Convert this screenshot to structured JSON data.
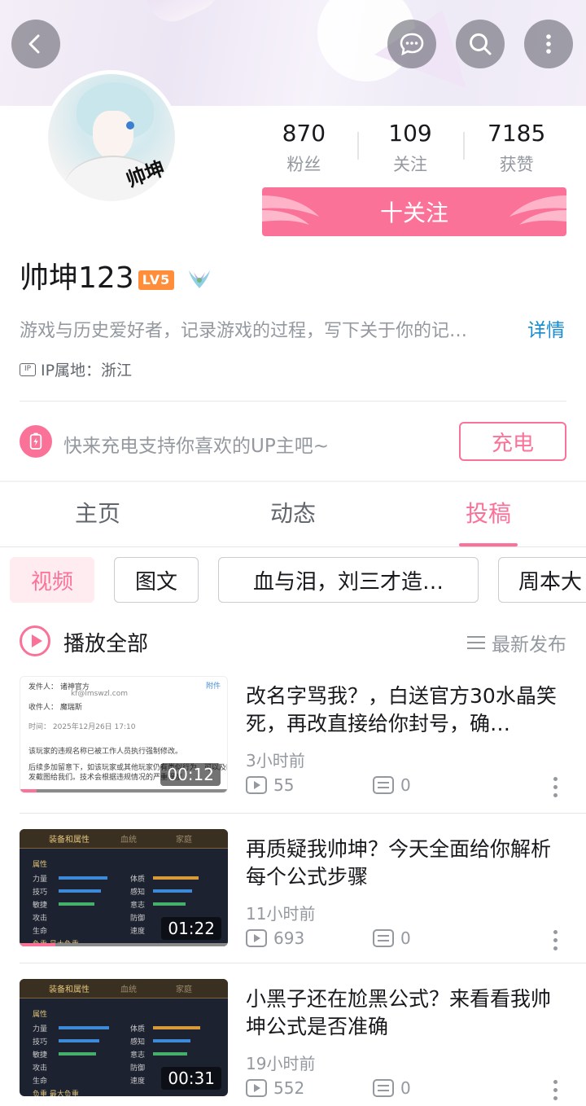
{
  "header": {
    "back_icon": "chevron-left-icon",
    "message_icon": "chat-bubble-icon",
    "search_icon": "search-icon",
    "more_icon": "more-vertical-icon"
  },
  "profile": {
    "avatar_text": "帅坤",
    "name": "帅坤123",
    "level": "LV5",
    "bio": "游戏与历史爱好者，记录游戏的过程，写下关于你的记…",
    "bio_more": "详情",
    "ip": "IP属地：浙江",
    "ip_icon_text": "IP"
  },
  "stats": [
    {
      "value": "870",
      "label": "粉丝"
    },
    {
      "value": "109",
      "label": "关注"
    },
    {
      "value": "7185",
      "label": "获赞"
    }
  ],
  "follow_label": "十关注",
  "charge": {
    "text": "快来充电支持你喜欢的UP主吧~",
    "button": "充电"
  },
  "tabs": [
    {
      "label": "主页",
      "active": false
    },
    {
      "label": "动态",
      "active": false
    },
    {
      "label": "投稿",
      "active": true
    }
  ],
  "chips": [
    {
      "label": "视频",
      "active": true
    },
    {
      "label": "图文",
      "active": false
    },
    {
      "label": "血与泪，刘三才造…",
      "active": false
    },
    {
      "label": "周本大",
      "active": false
    }
  ],
  "play_all": "播放全部",
  "sort_label": "最新发布",
  "videos": [
    {
      "title": "改名字骂我？，白送官方30水晶笑死，再改直接给你封号，确…",
      "time": "3小时前",
      "plays": "55",
      "danmaku": "0",
      "duration": "00:12",
      "progress": 0.08,
      "thumb_lines": [
        "发件人：  诸神官方",
        "kf@lmswzl.com",
        "收件人：  魔瑞斯",
        "时间：  2025年12月26日 17:10",
        "该玩家的违规名称已被工作人员执行强制修改。",
        "后续多加留意下，如该玩家或其他玩家仍有类似行为，可以及时",
        "发截图给我们。技术会根据违规情况的严重程度"
      ],
      "thumb_tag": "附件"
    },
    {
      "title": "再质疑我帅坤？今天全面给你解析每个公式步骤",
      "time": "11小时前",
      "plays": "693",
      "danmaku": "0",
      "duration": "01:22",
      "progress": 0.17,
      "thumb_tabs": [
        "装备和属性",
        "血统",
        "家庭"
      ],
      "thumb_rows": [
        "属性",
        "力量",
        "技巧",
        "敏捷",
        "攻击",
        "生命",
        "负重 最大负重"
      ],
      "thumb_rows_right": [
        "体质",
        "感知",
        "意志",
        "防御",
        "速度"
      ]
    },
    {
      "title": "小黑子还在尬黑公式？来看看我帅坤公式是否准确",
      "time": "19小时前",
      "plays": "552",
      "danmaku": "0",
      "duration": "00:31",
      "progress": 0,
      "thumb_tabs": [
        "装备和属性",
        "血统",
        "家庭"
      ],
      "thumb_rows": [
        "属性",
        "力量",
        "技巧",
        "敏捷",
        "攻击",
        "生命",
        "负重 最大负重"
      ],
      "thumb_rows_right": [
        "体质",
        "感知",
        "意志",
        "防御",
        "速度"
      ]
    }
  ],
  "colors": {
    "accent": "#fb7299",
    "link": "#178bcf",
    "level": "#ff8d3a",
    "muted": "#9499a0"
  }
}
